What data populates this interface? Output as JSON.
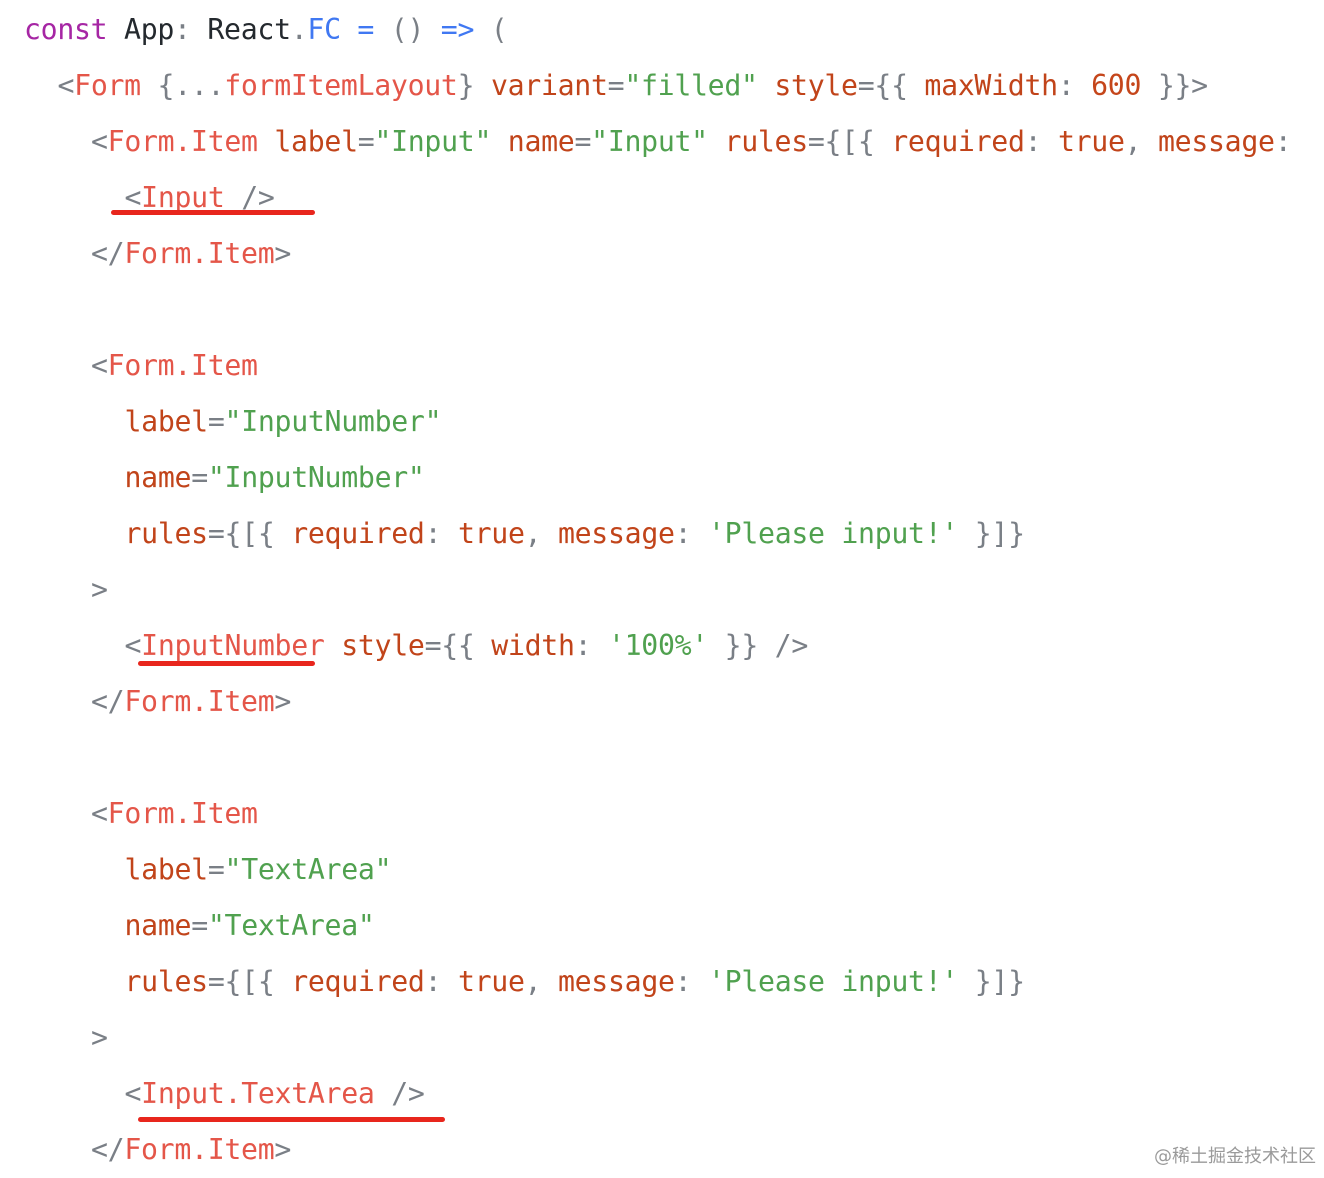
{
  "colors": {
    "keyword": "#a626a4",
    "plain": "#24292e",
    "type": "#4078f2",
    "tag": "#e45649",
    "attr": "#c1441a",
    "string": "#50a14f",
    "punct": "#7a7f86",
    "number": "#c5461b",
    "underline": "#e8261d"
  },
  "code_lines": [
    {
      "indent": 0,
      "tokens": [
        [
          "keyword",
          "const"
        ],
        [
          "plain",
          " App"
        ],
        [
          "punct",
          ": "
        ],
        [
          "plain",
          "React"
        ],
        [
          "punct",
          "."
        ],
        [
          "type",
          "FC"
        ],
        [
          "type",
          " = "
        ],
        [
          "punct",
          "() "
        ],
        [
          "type",
          "=>"
        ],
        [
          "punct",
          " ("
        ]
      ]
    },
    {
      "indent": 1,
      "tokens": [
        [
          "punct",
          "<"
        ],
        [
          "tag",
          "Form"
        ],
        [
          "punct",
          " {..."
        ],
        [
          "tag",
          "formItemLayout"
        ],
        [
          "punct",
          "} "
        ],
        [
          "attr",
          "variant"
        ],
        [
          "punct",
          "="
        ],
        [
          "string",
          "\"filled\""
        ],
        [
          "punct",
          " "
        ],
        [
          "attr",
          "style"
        ],
        [
          "punct",
          "={{ "
        ],
        [
          "attr",
          "maxWidth"
        ],
        [
          "punct",
          ": "
        ],
        [
          "number",
          "600"
        ],
        [
          "punct",
          " }}>"
        ]
      ]
    },
    {
      "indent": 2,
      "tokens": [
        [
          "punct",
          "<"
        ],
        [
          "tag",
          "Form.Item"
        ],
        [
          "punct",
          " "
        ],
        [
          "attr",
          "label"
        ],
        [
          "punct",
          "="
        ],
        [
          "string",
          "\"Input\""
        ],
        [
          "punct",
          " "
        ],
        [
          "attr",
          "name"
        ],
        [
          "punct",
          "="
        ],
        [
          "string",
          "\"Input\""
        ],
        [
          "punct",
          " "
        ],
        [
          "attr",
          "rules"
        ],
        [
          "punct",
          "={[{ "
        ],
        [
          "attr",
          "required"
        ],
        [
          "punct",
          ": "
        ],
        [
          "attr",
          "true"
        ],
        [
          "punct",
          ", "
        ],
        [
          "attr",
          "message"
        ],
        [
          "punct",
          ":"
        ]
      ]
    },
    {
      "indent": 3,
      "tokens": [
        [
          "punct",
          "<"
        ],
        [
          "tag",
          "Input"
        ],
        [
          "punct",
          " />"
        ]
      ]
    },
    {
      "indent": 2,
      "tokens": [
        [
          "punct",
          "</"
        ],
        [
          "tag",
          "Form.Item"
        ],
        [
          "punct",
          ">"
        ]
      ]
    },
    {
      "indent": 0,
      "tokens": []
    },
    {
      "indent": 2,
      "tokens": [
        [
          "punct",
          "<"
        ],
        [
          "tag",
          "Form.Item"
        ]
      ]
    },
    {
      "indent": 3,
      "tokens": [
        [
          "attr",
          "label"
        ],
        [
          "punct",
          "="
        ],
        [
          "string",
          "\"InputNumber\""
        ]
      ]
    },
    {
      "indent": 3,
      "tokens": [
        [
          "attr",
          "name"
        ],
        [
          "punct",
          "="
        ],
        [
          "string",
          "\"InputNumber\""
        ]
      ]
    },
    {
      "indent": 3,
      "tokens": [
        [
          "attr",
          "rules"
        ],
        [
          "punct",
          "={[{ "
        ],
        [
          "attr",
          "required"
        ],
        [
          "punct",
          ": "
        ],
        [
          "attr",
          "true"
        ],
        [
          "punct",
          ", "
        ],
        [
          "attr",
          "message"
        ],
        [
          "punct",
          ": "
        ],
        [
          "string",
          "'Please input!'"
        ],
        [
          "punct",
          " }]}"
        ]
      ]
    },
    {
      "indent": 2,
      "tokens": [
        [
          "punct",
          ">"
        ]
      ]
    },
    {
      "indent": 3,
      "tokens": [
        [
          "punct",
          "<"
        ],
        [
          "tag",
          "InputNumber"
        ],
        [
          "punct",
          " "
        ],
        [
          "attr",
          "style"
        ],
        [
          "punct",
          "={{ "
        ],
        [
          "attr",
          "width"
        ],
        [
          "punct",
          ": "
        ],
        [
          "string",
          "'100%'"
        ],
        [
          "punct",
          " }} />"
        ]
      ]
    },
    {
      "indent": 2,
      "tokens": [
        [
          "punct",
          "</"
        ],
        [
          "tag",
          "Form.Item"
        ],
        [
          "punct",
          ">"
        ]
      ]
    },
    {
      "indent": 0,
      "tokens": []
    },
    {
      "indent": 2,
      "tokens": [
        [
          "punct",
          "<"
        ],
        [
          "tag",
          "Form.Item"
        ]
      ]
    },
    {
      "indent": 3,
      "tokens": [
        [
          "attr",
          "label"
        ],
        [
          "punct",
          "="
        ],
        [
          "string",
          "\"TextArea\""
        ]
      ]
    },
    {
      "indent": 3,
      "tokens": [
        [
          "attr",
          "name"
        ],
        [
          "punct",
          "="
        ],
        [
          "string",
          "\"TextArea\""
        ]
      ]
    },
    {
      "indent": 3,
      "tokens": [
        [
          "attr",
          "rules"
        ],
        [
          "punct",
          "={[{ "
        ],
        [
          "attr",
          "required"
        ],
        [
          "punct",
          ": "
        ],
        [
          "attr",
          "true"
        ],
        [
          "punct",
          ", "
        ],
        [
          "attr",
          "message"
        ],
        [
          "punct",
          ": "
        ],
        [
          "string",
          "'Please input!'"
        ],
        [
          "punct",
          " }]}"
        ]
      ]
    },
    {
      "indent": 2,
      "tokens": [
        [
          "punct",
          ">"
        ]
      ]
    },
    {
      "indent": 3,
      "tokens": [
        [
          "punct",
          "<"
        ],
        [
          "tag",
          "Input.TextArea"
        ],
        [
          "punct",
          " />"
        ]
      ]
    },
    {
      "indent": 2,
      "tokens": [
        [
          "punct",
          "</"
        ],
        [
          "tag",
          "Form.Item"
        ],
        [
          "punct",
          ">"
        ]
      ]
    }
  ],
  "watermark": "@稀土掘金技术社区"
}
